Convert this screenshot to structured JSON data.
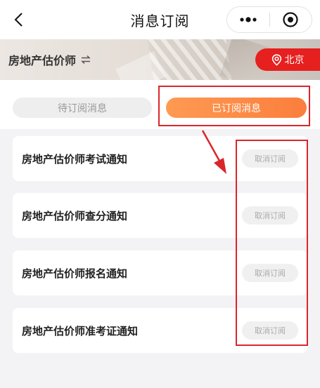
{
  "navbar": {
    "back_icon": "chevron-left-icon",
    "title": "消息订阅",
    "more_icon": "more-dots-icon",
    "close_icon": "record-target-icon"
  },
  "header": {
    "category": "房地产估价师",
    "switch_icon": "swap-arrows-icon",
    "location_icon": "location-pin-icon",
    "city": "北京"
  },
  "tabs": [
    {
      "label": "待订阅消息",
      "active": false
    },
    {
      "label": "已订阅消息",
      "active": true
    }
  ],
  "subscriptions": [
    {
      "title": "房地产估价师考试通知",
      "action": "取消订阅"
    },
    {
      "title": "房地产估价师查分通知",
      "action": "取消订阅"
    },
    {
      "title": "房地产估价师报名通知",
      "action": "取消订阅"
    },
    {
      "title": "房地产估价师准考证通知",
      "action": "取消订阅"
    }
  ],
  "colors": {
    "accent_orange": "#fb7e3d",
    "city_red": "#e5201f",
    "annotation_red": "#d9262b"
  }
}
